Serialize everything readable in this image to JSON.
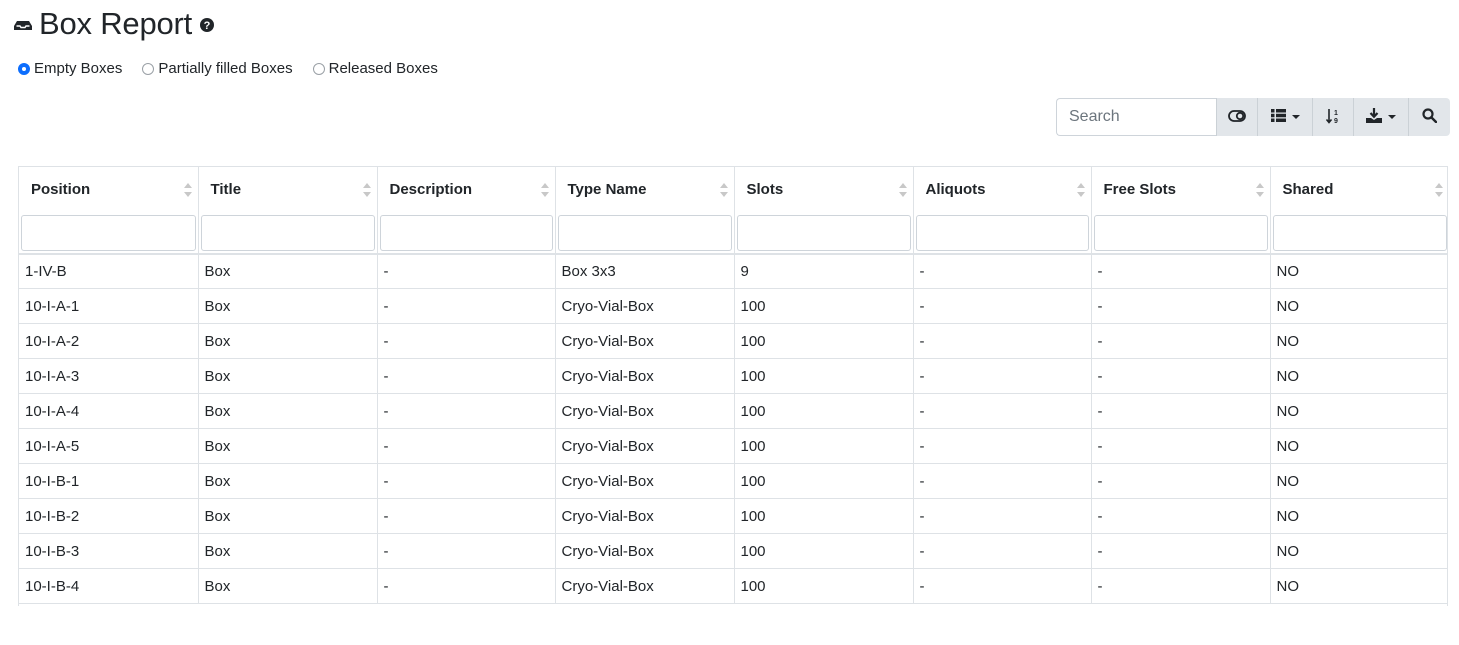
{
  "page": {
    "title": "Box Report",
    "title_icon": "box-icon",
    "help_icon": "question-circle-icon"
  },
  "filters": {
    "options": [
      {
        "label": "Empty Boxes",
        "checked": true
      },
      {
        "label": "Partially filled Boxes",
        "checked": false
      },
      {
        "label": "Released Boxes",
        "checked": false
      }
    ]
  },
  "toolbar": {
    "search_placeholder": "Search",
    "buttons": [
      {
        "icon": "toggle-icon"
      },
      {
        "icon": "columns-list-icon",
        "dropdown": true
      },
      {
        "icon": "sort-numeric-icon"
      },
      {
        "icon": "download-icon",
        "dropdown": true
      },
      {
        "icon": "search-icon"
      }
    ]
  },
  "table": {
    "columns": [
      "Position",
      "Title",
      "Description",
      "Type Name",
      "Slots",
      "Aliquots",
      "Free Slots",
      "Shared"
    ],
    "rows": [
      [
        "1-IV-B",
        "Box",
        "-",
        "Box 3x3",
        "9",
        "-",
        "-",
        "NO"
      ],
      [
        "10-I-A-1",
        "Box",
        "-",
        "Cryo-Vial-Box",
        "100",
        "-",
        "-",
        "NO"
      ],
      [
        "10-I-A-2",
        "Box",
        "-",
        "Cryo-Vial-Box",
        "100",
        "-",
        "-",
        "NO"
      ],
      [
        "10-I-A-3",
        "Box",
        "-",
        "Cryo-Vial-Box",
        "100",
        "-",
        "-",
        "NO"
      ],
      [
        "10-I-A-4",
        "Box",
        "-",
        "Cryo-Vial-Box",
        "100",
        "-",
        "-",
        "NO"
      ],
      [
        "10-I-A-5",
        "Box",
        "-",
        "Cryo-Vial-Box",
        "100",
        "-",
        "-",
        "NO"
      ],
      [
        "10-I-B-1",
        "Box",
        "-",
        "Cryo-Vial-Box",
        "100",
        "-",
        "-",
        "NO"
      ],
      [
        "10-I-B-2",
        "Box",
        "-",
        "Cryo-Vial-Box",
        "100",
        "-",
        "-",
        "NO"
      ],
      [
        "10-I-B-3",
        "Box",
        "-",
        "Cryo-Vial-Box",
        "100",
        "-",
        "-",
        "NO"
      ],
      [
        "10-I-B-4",
        "Box",
        "-",
        "Cryo-Vial-Box",
        "100",
        "-",
        "-",
        "NO"
      ]
    ]
  }
}
